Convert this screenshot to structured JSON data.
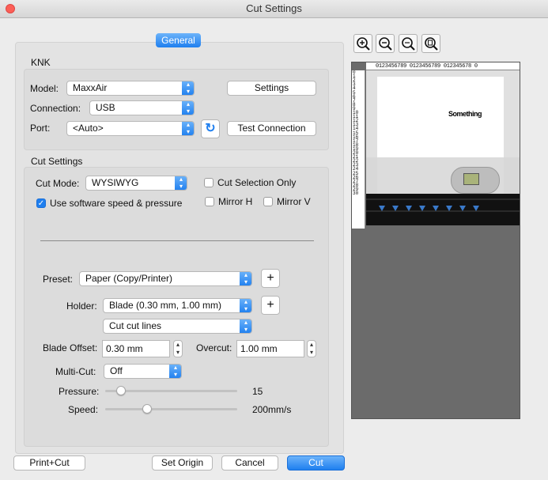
{
  "window": {
    "title": "Cut Settings"
  },
  "tab": {
    "label": "General"
  },
  "knk": {
    "section_label": "KNK",
    "model_label": "Model:",
    "model_value": "MaxxAir",
    "settings_button": "Settings",
    "connection_label": "Connection:",
    "connection_value": "USB",
    "port_label": "Port:",
    "port_value": "<Auto>",
    "test_connection_button": "Test Connection"
  },
  "cut_settings": {
    "section_label": "Cut Settings",
    "cut_mode_label": "Cut Mode:",
    "cut_mode_value": "WYSIWYG",
    "cut_selection_only_label": "Cut Selection Only",
    "cut_selection_only_checked": false,
    "use_software_label": "Use software speed & pressure",
    "use_software_checked": true,
    "mirror_h_label": "Mirror H",
    "mirror_h_checked": false,
    "mirror_v_label": "Mirror V",
    "mirror_v_checked": false,
    "preset_label": "Preset:",
    "preset_value": "Paper (Copy/Printer)",
    "holder_label": "Holder:",
    "holder_value": "Blade (0.30 mm, 1.00 mm)",
    "cut_lines_value": "Cut cut lines",
    "blade_offset_label": "Blade Offset:",
    "blade_offset_value": "0.30 mm",
    "overcut_label": "Overcut:",
    "overcut_value": "1.00 mm",
    "multicut_label": "Multi-Cut:",
    "multicut_value": "Off",
    "pressure_label": "Pressure:",
    "pressure_value": "15",
    "pressure_fraction": 0.09,
    "speed_label": "Speed:",
    "speed_value": "200mm/s",
    "speed_fraction": 0.3
  },
  "buttons": {
    "print_cut": "Print+Cut",
    "set_origin": "Set Origin",
    "cancel": "Cancel",
    "cut": "Cut"
  },
  "preview": {
    "toolbar": [
      "zoom-in-icon",
      "zoom-out-icon",
      "zoom-fit-icon",
      "zoom-page-icon"
    ],
    "top_ruler_text": "0123456789 0123456789 012345678 0",
    "left_ruler_numbers": [
      "0",
      "1",
      "2",
      "3",
      "4",
      "5",
      "6",
      "7",
      "8",
      "9",
      "10",
      "11",
      "12",
      "13",
      "14",
      "15",
      "16",
      "17",
      "18",
      "19",
      "20",
      "21",
      "22",
      "23",
      "24",
      "25",
      "26",
      "27",
      "28",
      "29",
      "30"
    ],
    "design_text": "Something"
  },
  "colors": {
    "accent": "#1f7fef",
    "close": "#fc5f57"
  }
}
